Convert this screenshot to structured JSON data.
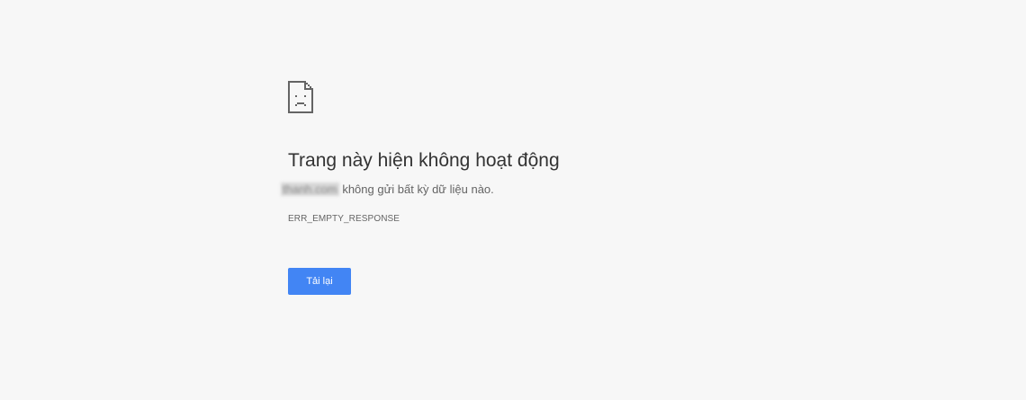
{
  "error_page": {
    "icon": "sad-page-icon",
    "heading": "Trang này hiện không hoạt động",
    "host": "thanh.com",
    "description_suffix": " không gửi bất kỳ dữ liệu nào.",
    "error_code": "ERR_EMPTY_RESPONSE",
    "reload_label": "Tải lại"
  },
  "colors": {
    "background": "#f7f7f7",
    "button": "#4285f4",
    "heading": "#333333",
    "text": "#646464"
  }
}
